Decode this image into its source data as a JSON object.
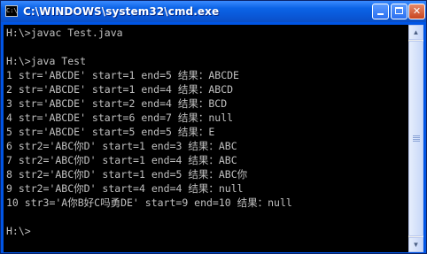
{
  "window": {
    "title": "C:\\WINDOWS\\system32\\cmd.exe",
    "icon_text": "C:\\",
    "icon": "console-app-icon",
    "buttons": {
      "minimize": "minimize-icon",
      "maximize": "maximize-icon",
      "close": "✕"
    }
  },
  "console": {
    "lines": [
      "H:\\>javac Test.java",
      "",
      "H:\\>java Test",
      "1 str='ABCDE' start=1 end=5 结果：ABCDE",
      "2 str='ABCDE' start=1 end=4 结果：ABCD",
      "3 str='ABCDE' start=2 end=4 结果：BCD",
      "4 str='ABCDE' start=6 end=7 结果：null",
      "5 str='ABCDE' start=5 end=5 结果：E",
      "6 str2='ABC你D' start=1 end=3 结果：ABC",
      "7 str2='ABC你D' start=1 end=4 结果：ABC",
      "8 str2='ABC你D' start=1 end=5 结果：ABC你",
      "9 str2='ABC你D' start=4 end=4 结果：null",
      "10 str3='A你B好C吗勇DE' start=9 end=10 结果：null",
      "",
      "H:\\>"
    ]
  },
  "scrollbar": {
    "up_arrow": "▲",
    "down_arrow": "▼"
  },
  "colors": {
    "title_bar": "#0a58d8",
    "console_bg": "#000000",
    "console_text": "#c0c0c0"
  }
}
